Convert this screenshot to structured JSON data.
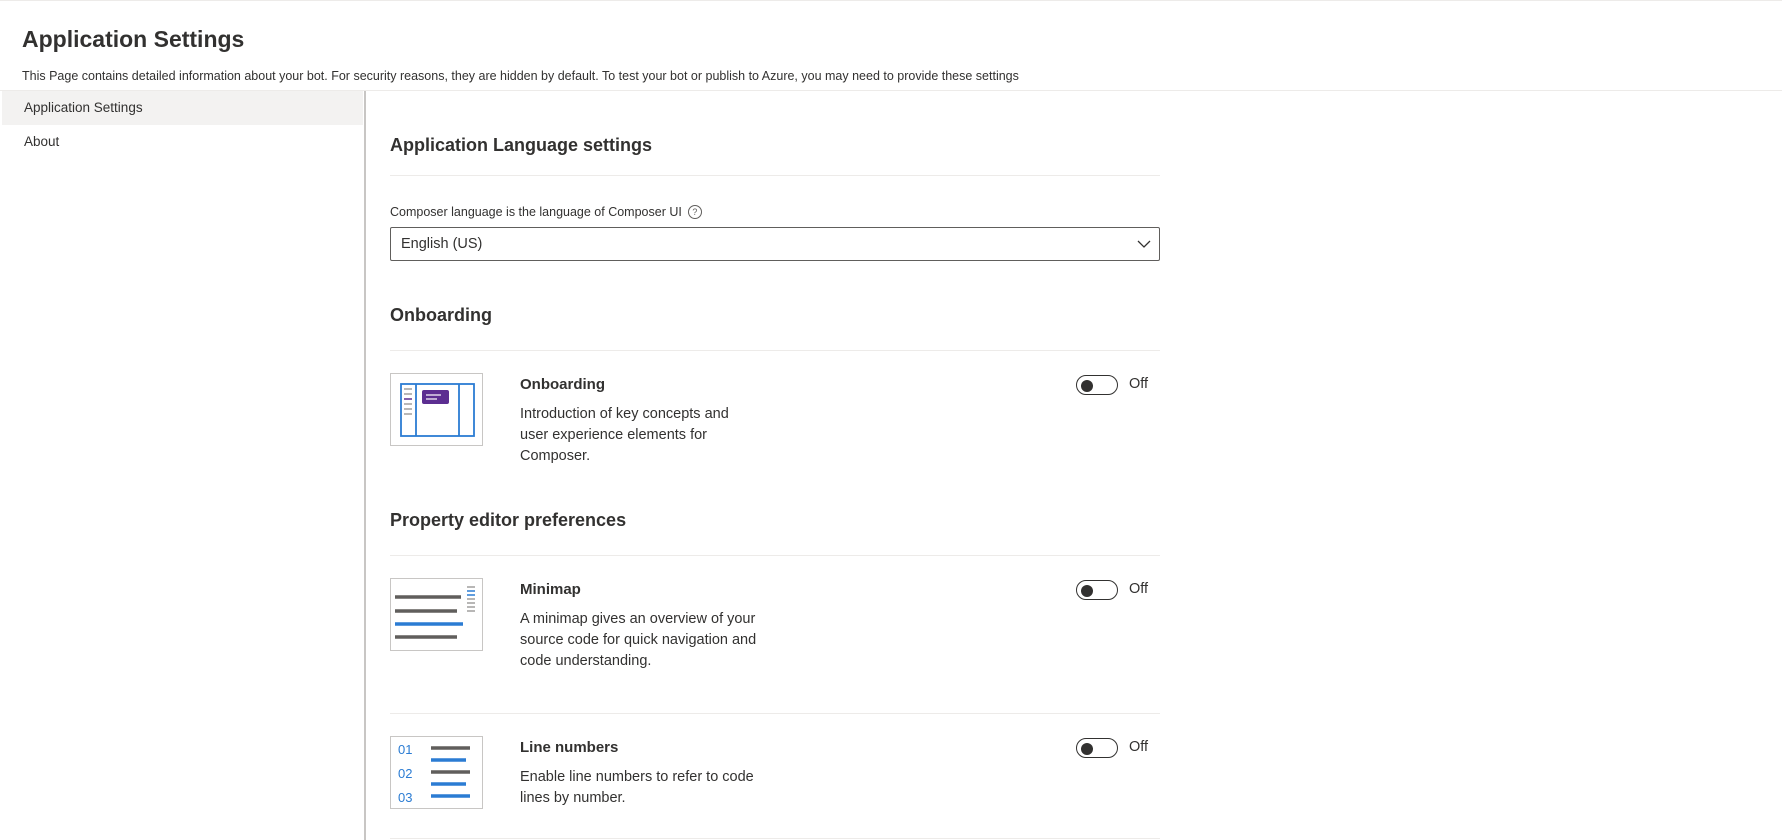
{
  "header": {
    "title": "Application Settings",
    "description": "This Page contains detailed information about your bot. For security reasons, they are hidden by default. To test your bot or publish to Azure, you may need to provide these settings"
  },
  "nav": {
    "items": [
      {
        "label": "Application Settings",
        "selected": true
      },
      {
        "label": "About",
        "selected": false
      }
    ]
  },
  "language": {
    "section_title": "Application Language settings",
    "label": "Composer language is the language of Composer UI",
    "help_icon": "?",
    "selected_value": "English (US)"
  },
  "onboarding": {
    "section_title": "Onboarding",
    "feature": {
      "title": "Onboarding",
      "description": "Introduction of key concepts and user experience elements for Composer.",
      "toggle_state": "Off"
    }
  },
  "property_editor": {
    "section_title": "Property editor preferences",
    "features": [
      {
        "title": "Minimap",
        "description": "A minimap gives an overview of your source code for quick navigation and code understanding.",
        "toggle_state": "Off"
      },
      {
        "title": "Line numbers",
        "description": "Enable line numbers to refer to code lines by number.",
        "toggle_state": "Off",
        "thumb_numbers": [
          "01",
          "02",
          "03"
        ]
      }
    ]
  },
  "colors": {
    "accent_blue": "#2b7cd3",
    "purple": "#5c2e91",
    "text": "#323130"
  }
}
